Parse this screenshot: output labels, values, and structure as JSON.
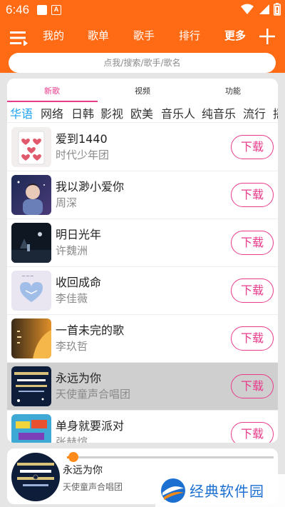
{
  "status": {
    "time": "6:46",
    "a_label": "A"
  },
  "nav": {
    "tabs": [
      "我的",
      "歌单",
      "歌手",
      "排行",
      "更多"
    ],
    "active_index": 4
  },
  "search": {
    "placeholder": "点我/搜索/歌手/歌名"
  },
  "sub_tabs": [
    "新歌",
    "视频",
    "功能"
  ],
  "categories": [
    "华语",
    "网络",
    "日韩",
    "影视",
    "欧美",
    "音乐人",
    "纯音乐",
    "流行",
    "摇"
  ],
  "songs": [
    {
      "title": "爱到1440",
      "artist": "时代少年团",
      "download": "下载"
    },
    {
      "title": "我以渺小爱你",
      "artist": "周深",
      "download": "下载"
    },
    {
      "title": "明日光年",
      "artist": "许魏洲",
      "download": "下载"
    },
    {
      "title": "收回成命",
      "artist": "李佳薇",
      "download": "下载"
    },
    {
      "title": "一首未完的歌",
      "artist": "李玖哲",
      "download": "下载"
    },
    {
      "title": "永远为你",
      "artist": "天使童声合唱团",
      "download": "下载"
    },
    {
      "title": "单身就要派对",
      "artist": "张赫煊",
      "download": "下载"
    }
  ],
  "player": {
    "title": "永远为你",
    "artist": "天使童声合唱团",
    "progress": 0.03
  },
  "watermark": {
    "text": "经典软件园"
  },
  "colors": {
    "brand": "#ff6a14",
    "accent": "#e83a8b",
    "category_active": "#1da1f2",
    "progress": "#ff8c1a"
  }
}
